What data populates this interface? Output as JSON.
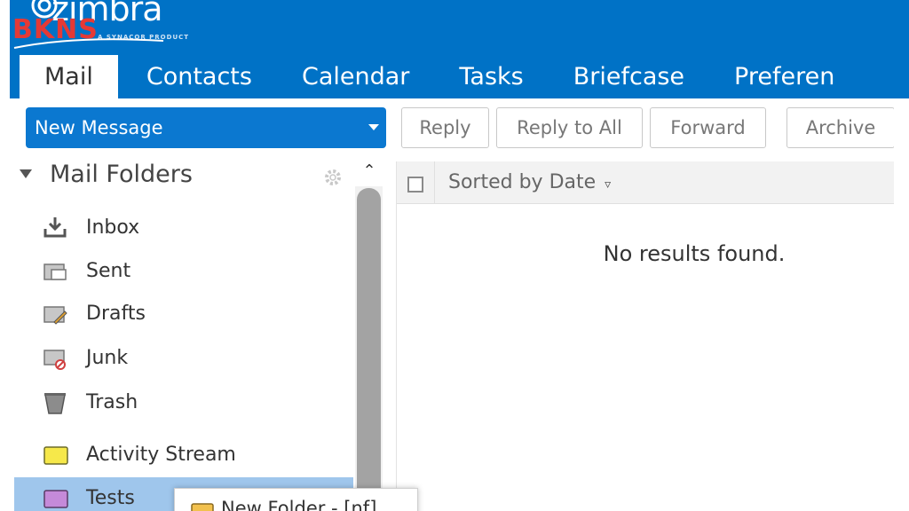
{
  "brand": {
    "logo_word": "zimbra",
    "logo_sub": "A SYNACOR PRODUCT",
    "watermark": "BKNS"
  },
  "app_tabs": [
    {
      "label": "Mail"
    },
    {
      "label": "Contacts"
    },
    {
      "label": "Calendar"
    },
    {
      "label": "Tasks"
    },
    {
      "label": "Briefcase"
    },
    {
      "label": "Preferen"
    }
  ],
  "toolbar": {
    "new_message": "New Message",
    "reply": "Reply",
    "reply_all": "Reply to All",
    "forward": "Forward",
    "archive": "Archive"
  },
  "sidebar": {
    "title": "Mail Folders",
    "folders": [
      {
        "label": "Inbox",
        "icon": "inbox-icon"
      },
      {
        "label": "Sent",
        "icon": "sent-folder-icon"
      },
      {
        "label": "Drafts",
        "icon": "drafts-folder-icon"
      },
      {
        "label": "Junk",
        "icon": "junk-folder-icon"
      },
      {
        "label": "Trash",
        "icon": "trash-icon"
      },
      {
        "label": "Activity Stream",
        "icon": "yellow-folder-icon"
      },
      {
        "label": "Tests",
        "icon": "purple-folder-icon"
      }
    ]
  },
  "list": {
    "sort_label": "Sorted by Date",
    "empty_text": "No results found."
  },
  "drag_tip": {
    "label": "New Folder - [nf]"
  },
  "colors": {
    "header_blue": "#0072c6",
    "button_blue": "#0b78d0",
    "selected_folder": "#9fc6ec"
  }
}
